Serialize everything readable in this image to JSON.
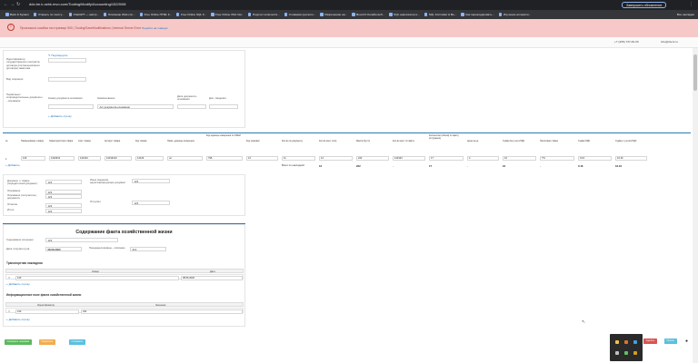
{
  "browser": {
    "url": "ddo.tm.k.ozbk.mvo.com/Tooling/Modify/Accounting/152/0/08",
    "update_label": "Завершить обновление",
    "bookmarks": [
      "Back & System",
      "Открыть по тексту...",
      "ChatGPT — настр...",
      "Описание Web-стр...",
      "Free Online HTML F...",
      "Free Online SQL F...",
      "Free Online XML Val...",
      "Подсчет количеств...",
      "Словарик русского...",
      "Разрешение на...",
      "Boot-hit Онлайн веб...",
      "SQL анализатор и...",
      "SQL Formatter & Be...",
      "Как перекодировать...",
      "Изучение алгоритм..."
    ],
    "bookmarks_more": "Все закладки"
  },
  "error": {
    "text": "Произошла ошибка на странице 500 | Tooling/SaveModifications | Internal Server Error",
    "link": "Перейти на главную"
  },
  "header": {
    "phone": "+7 (495) 737-00-00",
    "email": "info@client.ru"
  },
  "form1": {
    "counterparty_label": "Идентификатор государственного контракта, договора (соглашения/иного договора) заказчика",
    "counterparty_link": "Подтвердить",
    "code_label": "Вид операции",
    "docs_label": "Первичные/сопроводительные документы - основание",
    "doc_number_label": "Номер документа-основания",
    "doc_name_label": "Наименование",
    "doc_name_value": "Акт документа-основания",
    "doc_date_label": "Дата документа - основания",
    "extra_label": "Доп. сведения",
    "add_link": "Добавить строку"
  },
  "table": {
    "headers": [
      "№",
      "Наименование товара",
      "Характеристика товара",
      "Сорт товара",
      "Артикул товара",
      "Код товара",
      "Наим. единицы измерения",
      "Код единицы измерения по ОКЕИ",
      "Код упаковки",
      "Кол-во по документу",
      "Кол-во мест сопр.",
      "Масса брутто",
      "Кол-во мест по факту",
      "Количество (объём) по факту (отгружено)",
      "Цена за ед.",
      "Сумма без учета НДС",
      "Налоговая ставка",
      "Сумма НДС",
      "Сумма с учетом НДС"
    ],
    "row": [
      "1",
      "123",
      "1232313",
      "123123",
      "12313123",
      "12123",
      "шт",
      "796",
      "12",
      "11",
      "12",
      "222",
      "123123",
      "17",
      "4",
      "16",
      "7%",
      "0.16",
      "16.16"
    ],
    "totals_label": "Всего по накладной",
    "totals": [
      "12",
      "222",
      "-",
      "17",
      "-",
      "16",
      "-",
      "0.16",
      "16.16"
    ],
    "add_link": "Добавить"
  },
  "form2": {
    "fields_left": [
      {
        "label": "Документ о товаре (передаточный документ)",
        "value": "123"
      },
      {
        "label": "Основание",
        "value": "123"
      },
      {
        "label": "Основание (получатель) документа",
        "value": "123"
      },
      {
        "label": "Отметка",
        "value": "123"
      },
      {
        "label": "Итого",
        "value": "123"
      }
    ],
    "fields_right": [
      {
        "label": "Иные сведения, идентифицирующие документ",
        "value": "123"
      },
      {
        "label": "Отгрузил",
        "value": "123"
      }
    ]
  },
  "fact": {
    "title": "Содержание факта хозяйственной жизни",
    "content_label": "Содержание операции",
    "content_value": "123",
    "date_label": "Дата отгрузки груза",
    "date_value": "08.06.2020",
    "delivered_label": "Переданы/оказаны - описание",
    "delivered_value": "213",
    "transport_title": "Транспортная накладная",
    "transport_headers": [
      "Номер",
      "Дата"
    ],
    "transport_row": [
      "123",
      "08.06.2020"
    ],
    "transport_add": "Добавить строку",
    "info_title": "Информационное поле факта хозяйственной жизни",
    "info_headers": [
      "Идентификатор",
      "Значение"
    ],
    "info_row": [
      "213",
      "341"
    ],
    "info_add": "Добавить строку"
  },
  "buttons": {
    "save": "Сохранить черновик",
    "sign": "Подписать",
    "send": "Отправить",
    "delete": "Удалить",
    "print": "Печать"
  },
  "colors": {
    "accent": "#2a7ab5",
    "error_bg": "#f6c8c8",
    "btn_green": "#5cb85c",
    "btn_orange": "#f0ad4e",
    "btn_blue": "#5bc0de",
    "btn_red": "#d9534f"
  }
}
